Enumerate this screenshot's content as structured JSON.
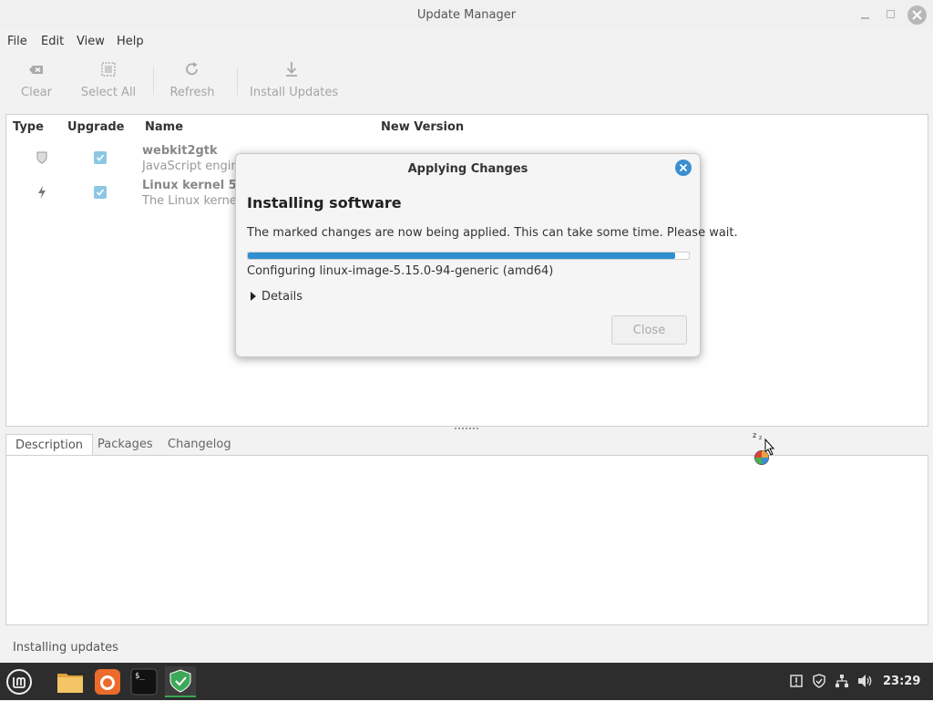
{
  "window": {
    "title": "Update Manager"
  },
  "menu": [
    "File",
    "Edit",
    "View",
    "Help"
  ],
  "toolbar": {
    "clear": "Clear",
    "select_all": "Select All",
    "refresh": "Refresh",
    "install_updates": "Install Updates"
  },
  "list": {
    "columns": [
      "Type",
      "Upgrade",
      "Name",
      "New Version"
    ],
    "rows": [
      {
        "type_icon": "shield-icon",
        "checked": true,
        "name": "webkit2gtk",
        "description": "JavaScript engine"
      },
      {
        "type_icon": "lightning-icon",
        "checked": true,
        "name": "Linux kernel 5.1",
        "description": "The Linux kernel"
      }
    ]
  },
  "tabs": [
    "Description",
    "Packages",
    "Changelog"
  ],
  "status": "Installing updates",
  "dialog": {
    "title": "Applying Changes",
    "heading": "Installing software",
    "message": "The marked changes are now being applied. This can take some time. Please wait.",
    "progress": 0.97,
    "status": "Configuring linux-image-5.15.0-94-generic (amd64)",
    "details": "Details",
    "close": "Close"
  },
  "taskbar": {
    "apps": [
      "mint-menu-icon",
      "files-icon",
      "firefox-icon",
      "terminal-icon",
      "update-manager-icon"
    ],
    "clock": "23:29"
  },
  "colors": {
    "accent": "#2f8fd1",
    "checkbox": "#8dc7e4",
    "taskbar": "#2d2d2d",
    "active_indicator": "#35a854"
  }
}
